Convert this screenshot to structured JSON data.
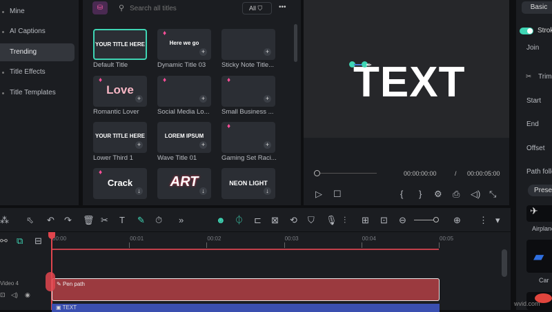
{
  "sidebar": {
    "items": [
      {
        "label": "Mine"
      },
      {
        "label": "AI Captions"
      },
      {
        "label": "Trending",
        "active": true
      },
      {
        "label": "Title Effects"
      },
      {
        "label": "Title Templates"
      }
    ]
  },
  "titles": {
    "search_placeholder": "Search all titles",
    "filter_label": "All",
    "more": "•••",
    "cards": [
      {
        "name": "Default Title",
        "thumb": "YOUR TITLE HERE",
        "premium": false
      },
      {
        "name": "Dynamic Title 03",
        "thumb": "Here we go",
        "premium": true
      },
      {
        "name": "Sticky Note Title...",
        "thumb": "",
        "premium": false
      },
      {
        "name": "Romantic Lover",
        "thumb": "Love",
        "premium": true
      },
      {
        "name": "Social Media Lo...",
        "thumb": "",
        "premium": true
      },
      {
        "name": "Small Business ...",
        "thumb": "",
        "premium": true
      },
      {
        "name": "Lower Third 1",
        "thumb": "YOUR TITLE HERE",
        "premium": false
      },
      {
        "name": "Wave Title 01",
        "thumb": "LOREM IPSUM",
        "premium": false
      },
      {
        "name": "Gaming Set Raci...",
        "thumb": "",
        "premium": true
      },
      {
        "name": "",
        "thumb": "Crack",
        "premium": true
      },
      {
        "name": "",
        "thumb": "ART",
        "premium": false
      },
      {
        "name": "",
        "thumb": "NEON LIGHT",
        "premium": false
      }
    ]
  },
  "preview": {
    "canvas_text": "TEXT",
    "current_time": "00:00:00:00",
    "separator": "/",
    "total_time": "00:00:05:00",
    "progress": 0
  },
  "props": {
    "tab": "Basic",
    "stroke_label": "Stroke",
    "stroke_on": true,
    "join": "Join",
    "trim": "Trim",
    "start": "Start",
    "end": "End",
    "offset": "Offset",
    "path_follow": "Path follow",
    "presets": "Presets",
    "preset_items": [
      "Airplane",
      "Car"
    ]
  },
  "timeline": {
    "ticks": [
      "00:00",
      "00:01",
      "00:02",
      "00:03",
      "00:04",
      "00:05"
    ],
    "track_label": "Video 4",
    "clips": [
      {
        "label": "Pen path",
        "color": "#9b3a3f"
      },
      {
        "label": "TEXT",
        "color": "#3a4fb0"
      }
    ]
  },
  "colors": {
    "accent": "#3fd6b5",
    "playhead": "#e0454d"
  },
  "watermark": "wvid.com"
}
